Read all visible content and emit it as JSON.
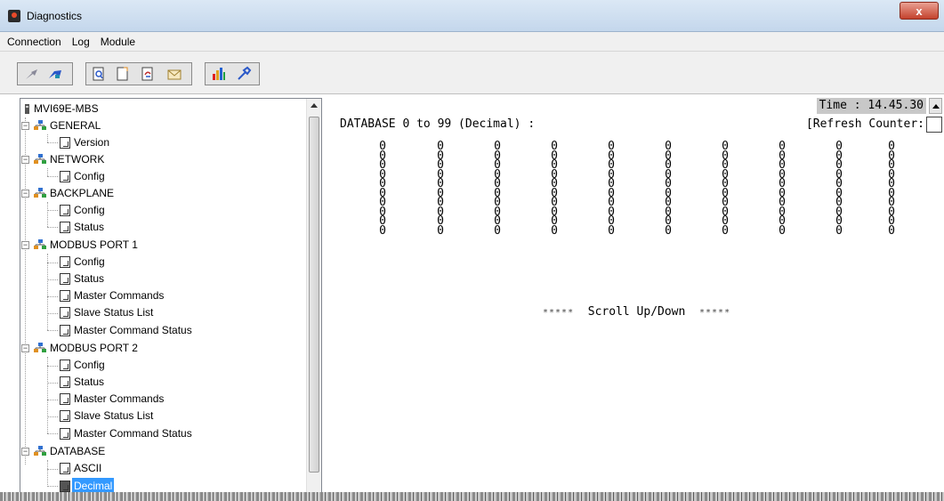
{
  "window": {
    "title": "Diagnostics",
    "close_label": "x"
  },
  "menu": {
    "items": [
      "Connection",
      "Log",
      "Module"
    ]
  },
  "toolbar": {
    "icons": [
      "disconnect-icon",
      "connect-icon",
      "find-icon",
      "new-document-icon",
      "refresh-icon",
      "mail-icon",
      "bar-chart-icon",
      "tools-icon"
    ]
  },
  "tree": {
    "root": "MVI69E-MBS",
    "nodes": [
      {
        "label": "GENERAL",
        "children": [
          "Version"
        ]
      },
      {
        "label": "NETWORK",
        "children": [
          "Config"
        ]
      },
      {
        "label": "BACKPLANE",
        "children": [
          "Config",
          "Status"
        ]
      },
      {
        "label": "MODBUS PORT 1",
        "children": [
          "Config",
          "Status",
          "Master Commands",
          "Slave Status List",
          "Master Command Status"
        ]
      },
      {
        "label": "MODBUS PORT 2",
        "children": [
          "Config",
          "Status",
          "Master Commands",
          "Slave Status List",
          "Master Command Status"
        ]
      },
      {
        "label": "DATABASE",
        "children": [
          "ASCII",
          "Decimal"
        ]
      }
    ],
    "selected": "Decimal"
  },
  "console": {
    "time_label": "Time : 14.45.30",
    "header": "DATABASE 0 to 99 (Decimal) :",
    "refresh_label": "[Refresh Counter:",
    "rows": [
      [
        "0",
        "0",
        "0",
        "0",
        "0",
        "0",
        "0",
        "0",
        "0",
        "0"
      ],
      [
        "0",
        "0",
        "0",
        "0",
        "0",
        "0",
        "0",
        "0",
        "0",
        "0"
      ],
      [
        "0",
        "0",
        "0",
        "0",
        "0",
        "0",
        "0",
        "0",
        "0",
        "0"
      ],
      [
        "0",
        "0",
        "0",
        "0",
        "0",
        "0",
        "0",
        "0",
        "0",
        "0"
      ],
      [
        "0",
        "0",
        "0",
        "0",
        "0",
        "0",
        "0",
        "0",
        "0",
        "0"
      ],
      [
        "0",
        "0",
        "0",
        "0",
        "0",
        "0",
        "0",
        "0",
        "0",
        "0"
      ],
      [
        "0",
        "0",
        "0",
        "0",
        "0",
        "0",
        "0",
        "0",
        "0",
        "0"
      ],
      [
        "0",
        "0",
        "0",
        "0",
        "0",
        "0",
        "0",
        "0",
        "0",
        "0"
      ],
      [
        "0",
        "0",
        "0",
        "0",
        "0",
        "0",
        "0",
        "0",
        "0",
        "0"
      ],
      [
        "0",
        "0",
        "0",
        "0",
        "0",
        "0",
        "0",
        "0",
        "0",
        "0"
      ]
    ],
    "scroll_stars": "*****",
    "scroll_text": "Scroll Up/Down"
  }
}
